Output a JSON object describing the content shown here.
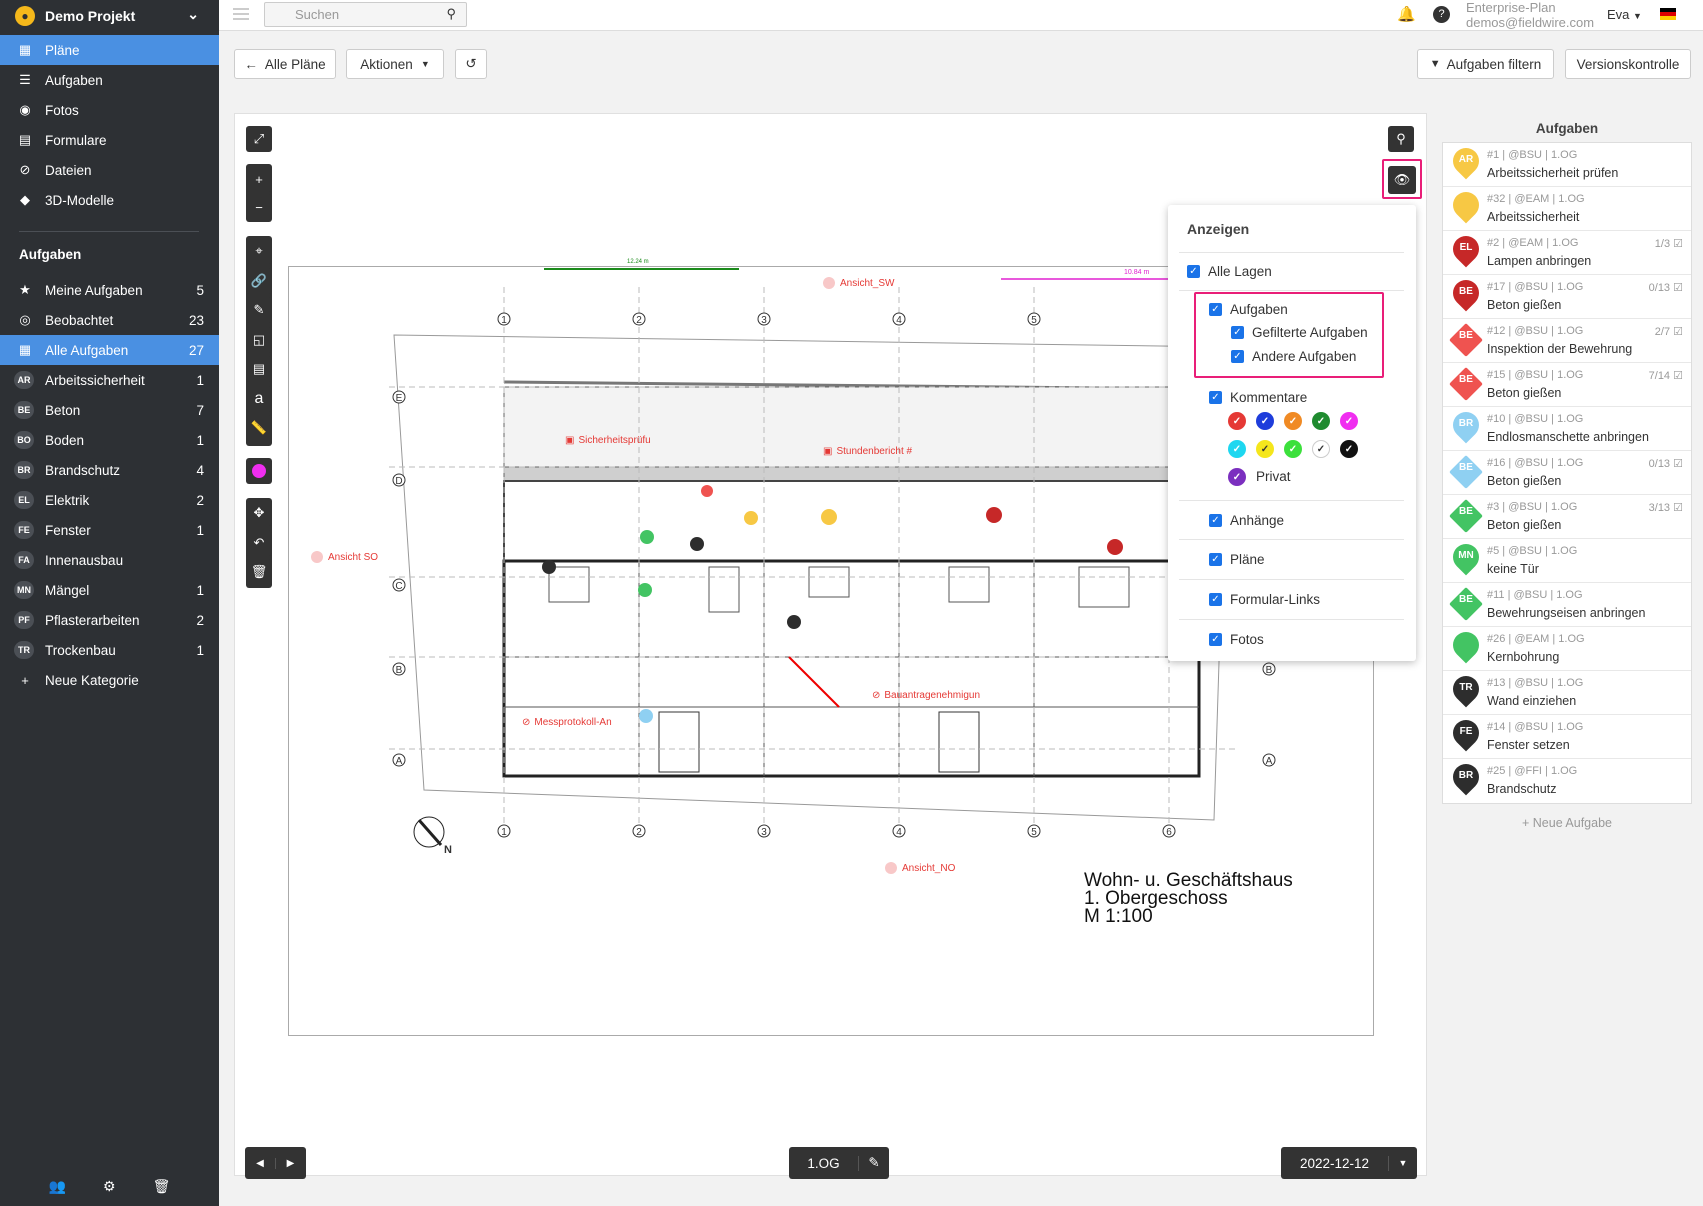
{
  "sidebar": {
    "project": "Demo Projekt",
    "nav": [
      {
        "label": "Pläne",
        "icon": "map-icon",
        "active": true
      },
      {
        "label": "Aufgaben",
        "icon": "list-icon"
      },
      {
        "label": "Fotos",
        "icon": "camera-icon"
      },
      {
        "label": "Formulare",
        "icon": "clipboard-icon"
      },
      {
        "label": "Dateien",
        "icon": "paperclip-icon"
      },
      {
        "label": "3D-Modelle",
        "icon": "cube-icon"
      }
    ],
    "section_title": "Aufgaben",
    "filters": [
      {
        "label": "Meine Aufgaben",
        "count": "5",
        "icon": "star-icon"
      },
      {
        "label": "Beobachtet",
        "count": "23",
        "icon": "eye-icon"
      },
      {
        "label": "Alle Aufgaben",
        "count": "27",
        "icon": "grid-icon",
        "active": true
      }
    ],
    "categories": [
      {
        "badge": "AR",
        "label": "Arbeitssicherheit",
        "count": "1"
      },
      {
        "badge": "BE",
        "label": "Beton",
        "count": "7"
      },
      {
        "badge": "BO",
        "label": "Boden",
        "count": "1"
      },
      {
        "badge": "BR",
        "label": "Brandschutz",
        "count": "4"
      },
      {
        "badge": "EL",
        "label": "Elektrik",
        "count": "2"
      },
      {
        "badge": "FE",
        "label": "Fenster",
        "count": "1"
      },
      {
        "badge": "FA",
        "label": "Innenausbau",
        "count": ""
      },
      {
        "badge": "MN",
        "label": "Mängel",
        "count": "1"
      },
      {
        "badge": "PF",
        "label": "Pflasterarbeiten",
        "count": "2"
      },
      {
        "badge": "TR",
        "label": "Trockenbau",
        "count": "1"
      }
    ],
    "new_category": "Neue Kategorie"
  },
  "header": {
    "search_placeholder": "Suchen",
    "plan": "Enterprise-Plan",
    "email": "demos@fieldwire.com",
    "user": "Eva"
  },
  "actions": {
    "all_plans": "Alle Pläne",
    "actions": "Aktionen",
    "filter_tasks": "Aufgaben filtern",
    "version_control": "Versionskontrolle"
  },
  "plan_sheet": {
    "title_line1": "Wohn- u. Geschäftshaus",
    "title_line2": "1. Obergeschoss",
    "title_line3": "M 1:100",
    "markers": [
      {
        "label": "Ansicht_SW"
      },
      {
        "label": "Ansicht SO"
      },
      {
        "label": "Ansicht_NO"
      },
      {
        "label": "Sicherheitsprüfu"
      },
      {
        "label": "Stundenbericht #"
      },
      {
        "label": "Bauantragenehmigun"
      },
      {
        "label": "Messprotokoll-An"
      }
    ],
    "dim_green": "12.24 m",
    "dim_magenta": "10.84 m",
    "compass": "N"
  },
  "anzeigen": {
    "title": "Anzeigen",
    "all_layers": "Alle Lagen",
    "tasks": "Aufgaben",
    "filtered_tasks": "Gefilterte Aufgaben",
    "other_tasks": "Andere Aufgaben",
    "comments": "Kommentare",
    "private": "Privat",
    "attachments": "Anhänge",
    "plans": "Pläne",
    "form_links": "Formular-Links",
    "photos": "Fotos",
    "colors_row1": [
      "#e53935",
      "#1e3ddb",
      "#f08a24",
      "#1f8b2f",
      "#f02ef0"
    ],
    "colors_row2": [
      "#1ed7f0",
      "#f5e61c",
      "#3ce03c",
      "#ffffff",
      "#111111"
    ],
    "private_color": "#7b2fbf"
  },
  "task_list": {
    "title": "Aufgaben",
    "new_task": "+ Neue Aufgabe",
    "items": [
      {
        "badge": "AR",
        "color": "#f7c844",
        "shape": "pin",
        "meta": "#1 | @BSU | 1.OG",
        "name": "Arbeitssicherheit prüfen",
        "frac": ""
      },
      {
        "badge": "",
        "color": "#f7c844",
        "shape": "pin",
        "meta": "#32 | @EAM | 1.OG",
        "name": "Arbeitssicherheit",
        "frac": ""
      },
      {
        "badge": "EL",
        "color": "#c62828",
        "shape": "pin",
        "meta": "#2 | @EAM | 1.OG",
        "name": "Lampen anbringen",
        "frac": "1/3"
      },
      {
        "badge": "BE",
        "color": "#c62828",
        "shape": "pin",
        "meta": "#17 | @BSU | 1.OG",
        "name": "Beton gießen",
        "frac": "0/13"
      },
      {
        "badge": "BE",
        "color": "#ef5350",
        "shape": "dia",
        "meta": "#12 | @BSU | 1.OG",
        "name": "Inspektion der Bewehrung",
        "frac": "2/7"
      },
      {
        "badge": "BE",
        "color": "#ef5350",
        "shape": "dia",
        "meta": "#15 | @BSU | 1.OG",
        "name": "Beton gießen",
        "frac": "7/14"
      },
      {
        "badge": "BR",
        "color": "#8fd0f2",
        "shape": "pin",
        "meta": "#10 | @BSU | 1.OG",
        "name": "Endlosmanschette anbringen",
        "frac": ""
      },
      {
        "badge": "BE",
        "color": "#8fd0f2",
        "shape": "dia",
        "meta": "#16 | @BSU | 1.OG",
        "name": "Beton gießen",
        "frac": "0/13"
      },
      {
        "badge": "BE",
        "color": "#43c463",
        "shape": "dia",
        "meta": "#3 | @BSU | 1.OG",
        "name": "Beton gießen",
        "frac": "3/13"
      },
      {
        "badge": "MN",
        "color": "#43c463",
        "shape": "pin",
        "meta": "#5 | @BSU | 1.OG",
        "name": "keine Tür",
        "frac": ""
      },
      {
        "badge": "BE",
        "color": "#43c463",
        "shape": "dia",
        "meta": "#11 | @BSU | 1.OG",
        "name": "Bewehrungseisen anbringen",
        "frac": ""
      },
      {
        "badge": "",
        "color": "#43c463",
        "shape": "pin",
        "meta": "#26 | @EAM | 1.OG",
        "name": "Kernbohrung",
        "frac": ""
      },
      {
        "badge": "TR",
        "color": "#2d2d2d",
        "shape": "pin",
        "meta": "#13 | @BSU | 1.OG",
        "name": "Wand einziehen",
        "frac": ""
      },
      {
        "badge": "FE",
        "color": "#2d2d2d",
        "shape": "pin",
        "meta": "#14 | @BSU | 1.OG",
        "name": "Fenster setzen",
        "frac": ""
      },
      {
        "badge": "BR",
        "color": "#2d2d2d",
        "shape": "pin",
        "meta": "#25 | @FFI | 1.OG",
        "name": "Brandschutz",
        "frac": ""
      }
    ]
  },
  "bottom": {
    "floor": "1.OG",
    "date": "2022-12-12"
  }
}
